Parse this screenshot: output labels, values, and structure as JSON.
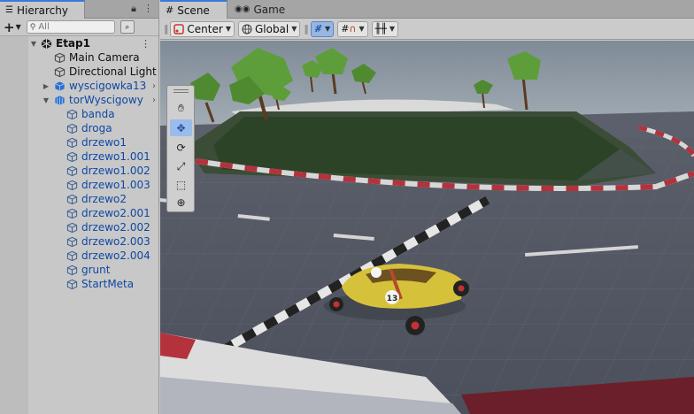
{
  "hierarchy": {
    "tab_label": "Hierarchy",
    "search_placeholder": "All",
    "items": [
      {
        "label": "Etap1",
        "depth": 0,
        "expanded": true,
        "bold": true,
        "blue": false,
        "icon": "unity-scene-icon"
      },
      {
        "label": "Main Camera",
        "depth": 1,
        "blue": false,
        "icon": "gameobject-cube-icon"
      },
      {
        "label": "Directional Light",
        "depth": 1,
        "blue": false,
        "icon": "gameobject-cube-icon"
      },
      {
        "label": "wyscigowka13",
        "depth": 1,
        "blue": true,
        "collapsed": true,
        "icon": "prefab-cube-icon"
      },
      {
        "label": "torWyscigowy",
        "depth": 1,
        "blue": true,
        "expanded": true,
        "icon": "prefab-model-icon"
      },
      {
        "label": "banda",
        "depth": 2,
        "blue": true,
        "icon": "gameobject-cube-icon"
      },
      {
        "label": "droga",
        "depth": 2,
        "blue": true,
        "icon": "gameobject-cube-icon"
      },
      {
        "label": "drzewo1",
        "depth": 2,
        "blue": true,
        "icon": "gameobject-cube-icon"
      },
      {
        "label": "drzewo1.001",
        "depth": 2,
        "blue": true,
        "icon": "gameobject-cube-icon"
      },
      {
        "label": "drzewo1.002",
        "depth": 2,
        "blue": true,
        "icon": "gameobject-cube-icon"
      },
      {
        "label": "drzewo1.003",
        "depth": 2,
        "blue": true,
        "icon": "gameobject-cube-icon"
      },
      {
        "label": "drzewo2",
        "depth": 2,
        "blue": true,
        "icon": "gameobject-cube-icon"
      },
      {
        "label": "drzewo2.001",
        "depth": 2,
        "blue": true,
        "icon": "gameobject-cube-icon"
      },
      {
        "label": "drzewo2.002",
        "depth": 2,
        "blue": true,
        "icon": "gameobject-cube-icon"
      },
      {
        "label": "drzewo2.003",
        "depth": 2,
        "blue": true,
        "icon": "gameobject-cube-icon"
      },
      {
        "label": "drzewo2.004",
        "depth": 2,
        "blue": true,
        "icon": "gameobject-cube-icon"
      },
      {
        "label": "grunt",
        "depth": 2,
        "blue": true,
        "icon": "gameobject-cube-icon"
      },
      {
        "label": "StartMeta",
        "depth": 2,
        "blue": true,
        "icon": "gameobject-cube-icon"
      }
    ]
  },
  "scene": {
    "tabs": [
      {
        "label": "Scene",
        "icon": "scene-grid-icon",
        "active": true
      },
      {
        "label": "Game",
        "icon": "gamepad-icon",
        "active": false
      }
    ],
    "toolbar": {
      "pivot_label": "Center",
      "space_label": "Global"
    },
    "tools": [
      "hand-tool-icon",
      "move-tool-icon",
      "rotate-tool-icon",
      "scale-tool-icon",
      "rect-tool-icon",
      "transform-tool-icon"
    ],
    "selected_tool": "move-tool-icon",
    "car_number": "13"
  },
  "colors": {
    "accent": "#3a79d6",
    "prefab_blue": "#0f48a3",
    "sky": "#8e9aa6",
    "track": "#5f6470",
    "grass": "#2e4a2a",
    "curb_red": "#b4323c",
    "car_yellow": "#d6c13a"
  }
}
